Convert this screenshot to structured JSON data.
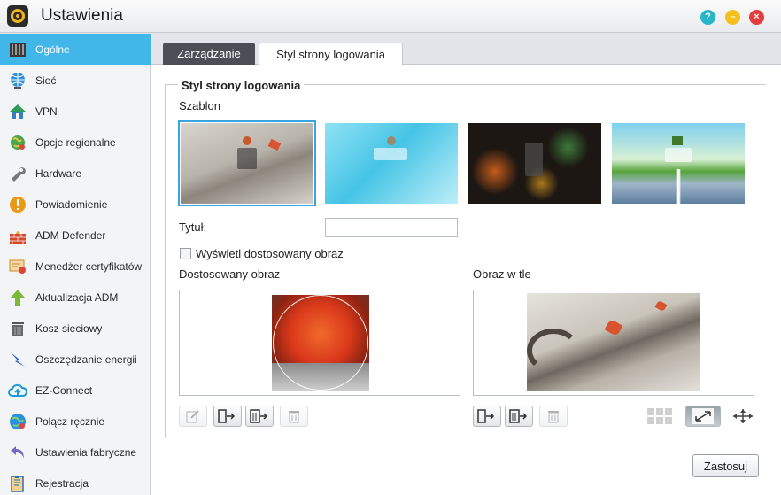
{
  "window": {
    "title": "Ustawienia"
  },
  "sidebar": {
    "items": [
      {
        "label": "Ogólne",
        "icon": "general-grid-icon",
        "active": true
      },
      {
        "label": "Sieć",
        "icon": "globe-network-icon"
      },
      {
        "label": "VPN",
        "icon": "vpn-house-icon"
      },
      {
        "label": "Opcje regionalne",
        "icon": "regional-globe-icon"
      },
      {
        "label": "Hardware",
        "icon": "wrench-icon"
      },
      {
        "label": "Powiadomienie",
        "icon": "exclamation-icon"
      },
      {
        "label": "ADM Defender",
        "icon": "firewall-icon"
      },
      {
        "label": "Menedżer certyfikatów",
        "icon": "certificate-icon"
      },
      {
        "label": "Aktualizacja ADM",
        "icon": "update-arrow-icon"
      },
      {
        "label": "Kosz sieciowy",
        "icon": "trash-icon"
      },
      {
        "label": "Oszczędzanie energii",
        "icon": "lightning-icon"
      },
      {
        "label": "EZ-Connect",
        "icon": "cloud-icon"
      },
      {
        "label": "Połącz ręcznie",
        "icon": "connect-globe-icon"
      },
      {
        "label": "Ustawienia fabryczne",
        "icon": "undo-arrow-icon"
      },
      {
        "label": "Rejestracja",
        "icon": "registration-icon"
      }
    ]
  },
  "tabs": [
    {
      "label": "Zarządzanie",
      "active": false
    },
    {
      "label": "Styl strony logowania",
      "active": true
    }
  ],
  "section": {
    "legend": "Styl strony logowania",
    "template_label": "Szablon",
    "title_label": "Tytuł:",
    "title_value": "",
    "custom_checkbox_label": "Wyświetl dostosowany obraz",
    "custom_checkbox_checked": false,
    "custom_image_label": "Dostosowany obraz",
    "background_label": "Obraz w tle"
  },
  "templates": {
    "selected_index": 0,
    "count": 4
  },
  "apply_button": "Zastosuj",
  "colors": {
    "accent": "#41b6e9",
    "selected_border": "#3aa3e0"
  }
}
